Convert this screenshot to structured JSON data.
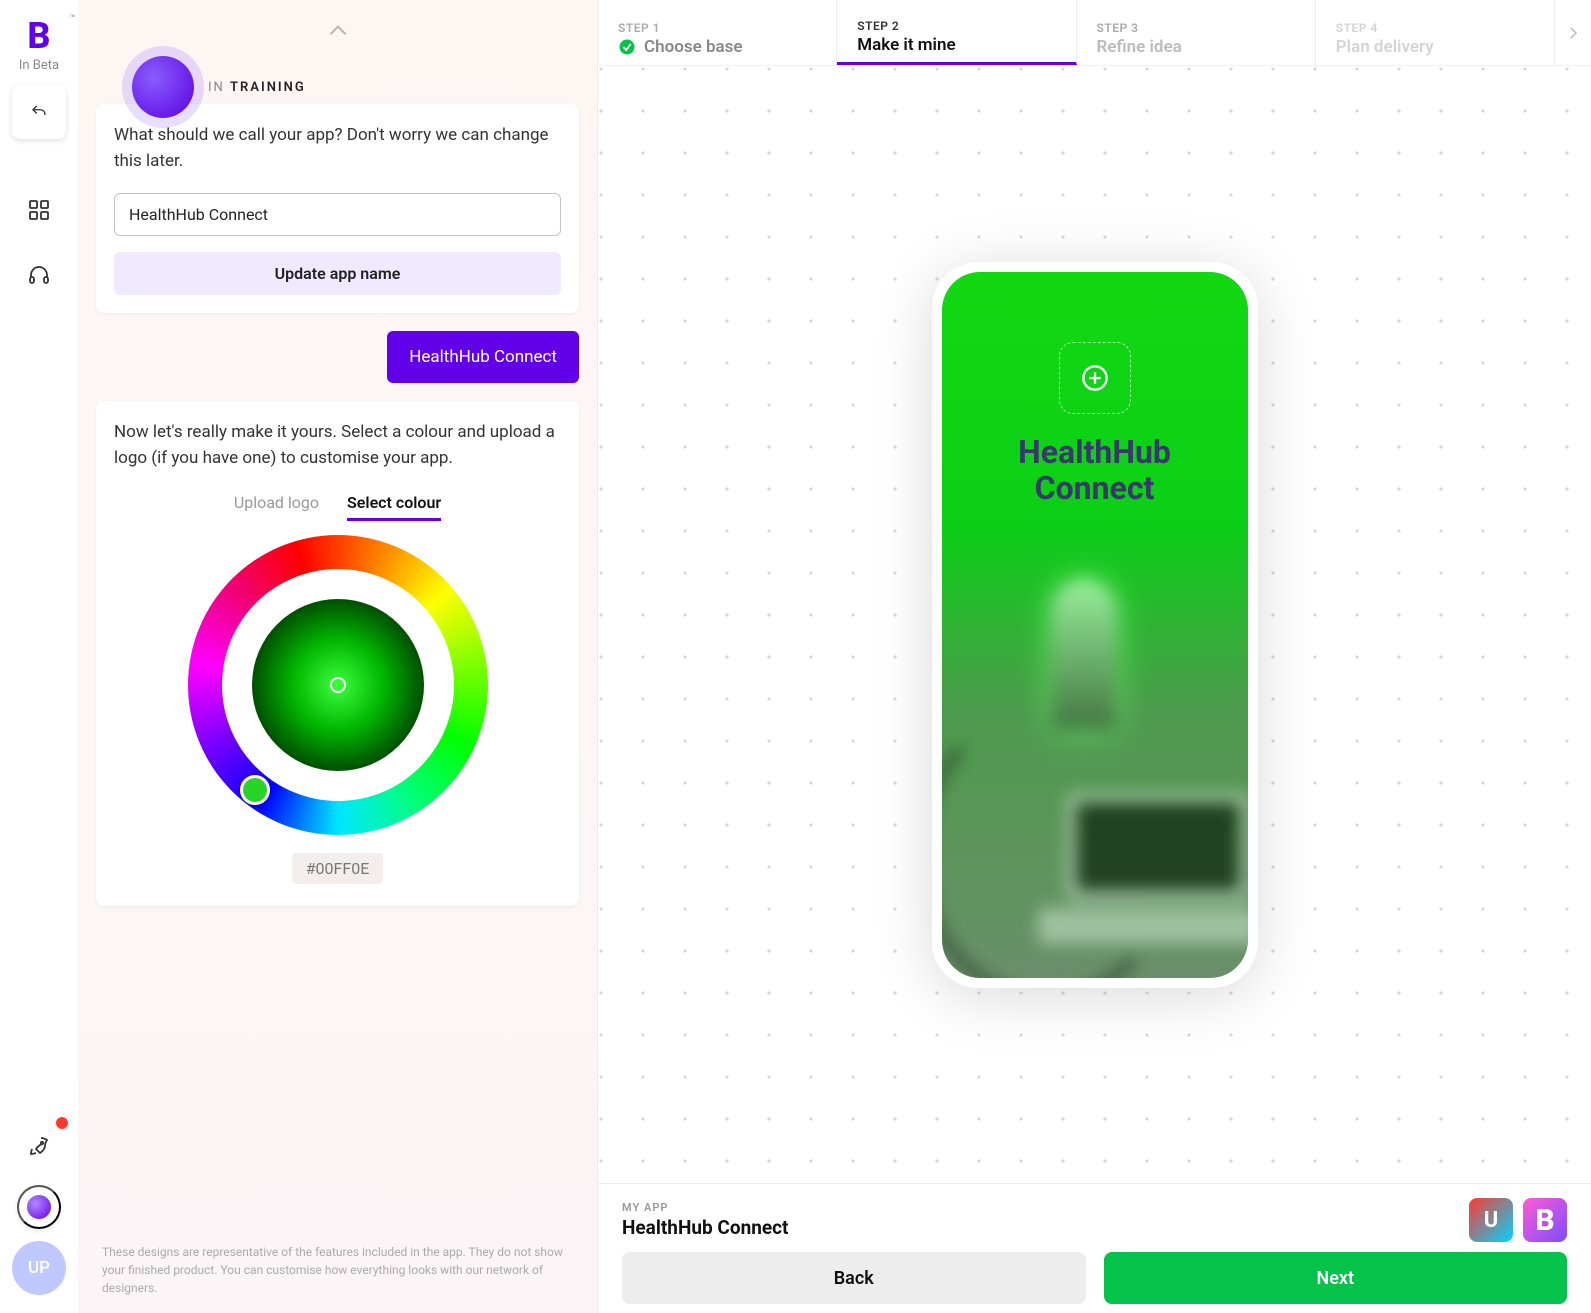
{
  "brand": {
    "letter": "B",
    "tm": "™",
    "beta": "In Beta"
  },
  "bot": {
    "status_prefix": "IN ",
    "status_word": "TRAINING"
  },
  "chat": {
    "name_prompt": "What should we call your app? Don't worry we can change this later.",
    "name_value": "HealthHub Connect",
    "update_btn": "Update app name",
    "user_reply": "HealthHub Connect",
    "customize_prompt": "Now let's really make it yours. Select a colour and upload a logo (if you have one) to customise your app.",
    "tabs": {
      "upload": "Upload logo",
      "colour": "Select colour"
    },
    "hex": "#00FF0E"
  },
  "disclaimer": "These designs are representative of the features included in the app. They do not show your finished product. You can customise how everything looks with our network of designers.",
  "steps": [
    {
      "n": "STEP 1",
      "t": "Choose base",
      "state": "done"
    },
    {
      "n": "STEP 2",
      "t": "Make it mine",
      "state": "active"
    },
    {
      "n": "STEP 3",
      "t": "Refine idea",
      "state": ""
    },
    {
      "n": "STEP 4",
      "t": "Plan delivery",
      "state": "dis"
    }
  ],
  "phone": {
    "title_l1": "HealthHub",
    "title_l2": "Connect"
  },
  "footer": {
    "label": "MY APP",
    "name": "HealthHub Connect",
    "back": "Back",
    "next": "Next",
    "thumb_letter": "U"
  },
  "avatar": "UP",
  "colors": {
    "accent": "#6200ea",
    "picked": "#00FF0E",
    "next_btn": "#05c34a"
  }
}
